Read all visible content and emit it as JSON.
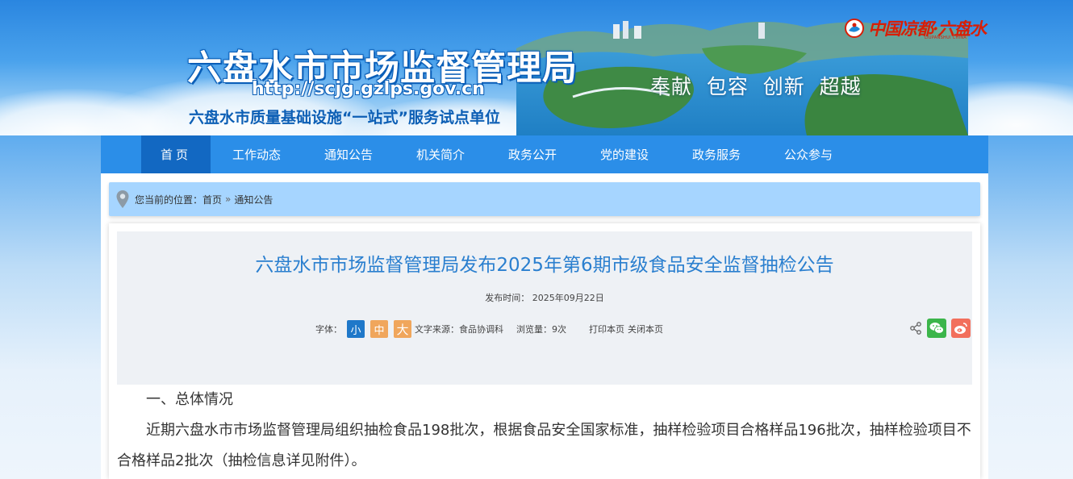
{
  "header": {
    "title": "六盘水市市场监督管理局",
    "url": "http://scjg.gzlps.gov.cn",
    "subtitle": "六盘水市质量基础设施“一站式”服务试点单位",
    "slogan": "奉献  包容  创新  超越",
    "logo_text": "中国凉都·六盘水",
    "logo_sub": "LIUPANSHUI CHINA"
  },
  "nav": {
    "items": [
      "首页",
      "工作动态",
      "通知公告",
      "机关简介",
      "政务公开",
      "党的建设",
      "政务服务",
      "公众参与"
    ]
  },
  "breadcrumb": {
    "prefix": "您当前的位置：",
    "home": "首页",
    "separator": "»",
    "current": "通知公告"
  },
  "article": {
    "title": "六盘水市市场监督管理局发布2025年第6期市级食品安全监督抽检公告",
    "publish_time": "发布时间： 2025年09月22日",
    "font_label": "字体：",
    "font_small": "小",
    "font_mid": "中",
    "font_big": "大",
    "source": "文字来源：食品协调科",
    "views": "浏览量：9次",
    "print": "打印本页",
    "close": "关闭本页",
    "section_heading": "一、总体情况",
    "paragraph": "近期六盘水市市场监督管理局组织抽检食品198批次，根据食品安全国家标准，抽样检验项目合格样品196批次，抽样检验项目不合格样品2批次（抽检信息详见附件）。"
  },
  "icons": {
    "location": "location-pin-icon",
    "share": "share-icon",
    "wechat": "wechat-icon",
    "weibo": "weibo-icon"
  },
  "colors": {
    "nav_bg": "#2b8ee8",
    "nav_active": "#1268c2",
    "title_blue": "#2a7fcf",
    "crumb_bg": "#a6d5ff"
  }
}
